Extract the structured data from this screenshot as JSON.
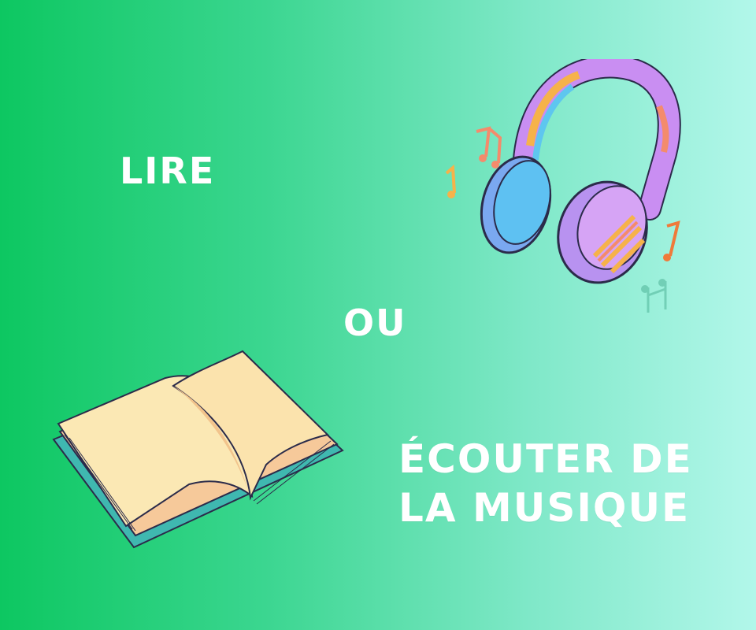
{
  "slide": {
    "background_gradient": [
      "#0dc761",
      "#b2f7ea"
    ],
    "word_color": "#ffffff",
    "lire": "LIRE",
    "ou": "OU",
    "ecouter_line1": "ÉCOUTER DE",
    "ecouter_line2": "LA MUSIQUE"
  },
  "illustrations": {
    "book": "open-book-icon",
    "headphones": "headphones-icon",
    "notes": [
      "music-note-icon",
      "music-note-icon",
      "music-note-icon",
      "music-note-icon"
    ]
  }
}
